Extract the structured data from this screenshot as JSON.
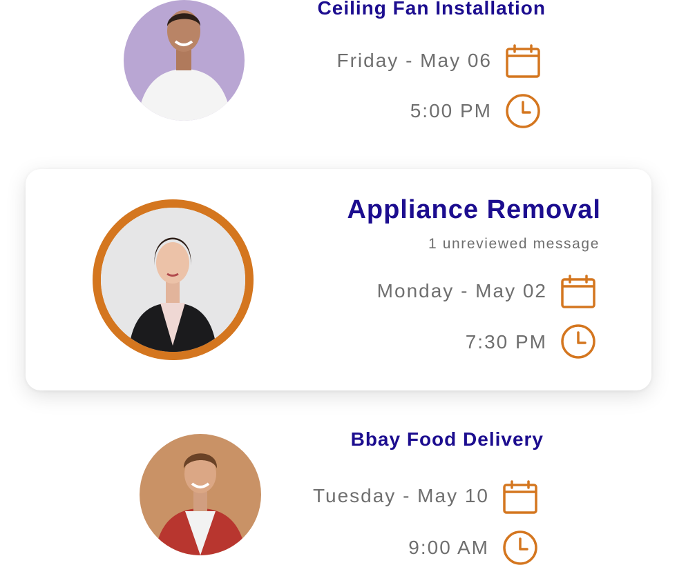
{
  "colors": {
    "title": "#1c0d8f",
    "muted_text": "#6f6f6f",
    "accent_orange": "#d4761f",
    "card_bg": "#ffffff"
  },
  "appointments": [
    {
      "title": "Ceiling Fan Installation",
      "date": "Friday - May 06",
      "time": "5:00 PM",
      "date_icon": "calendar-icon",
      "time_icon": "clock-icon"
    },
    {
      "title": "Appliance Removal",
      "subtitle": "1 unreviewed message",
      "date": "Monday - May 02",
      "time": "7:30 PM",
      "date_icon": "calendar-icon",
      "time_icon": "clock-icon",
      "highlighted": true
    },
    {
      "title": "Bbay Food Delivery",
      "date": "Tuesday - May 10",
      "time": "9:00 AM",
      "date_icon": "calendar-icon",
      "time_icon": "clock-icon"
    }
  ]
}
